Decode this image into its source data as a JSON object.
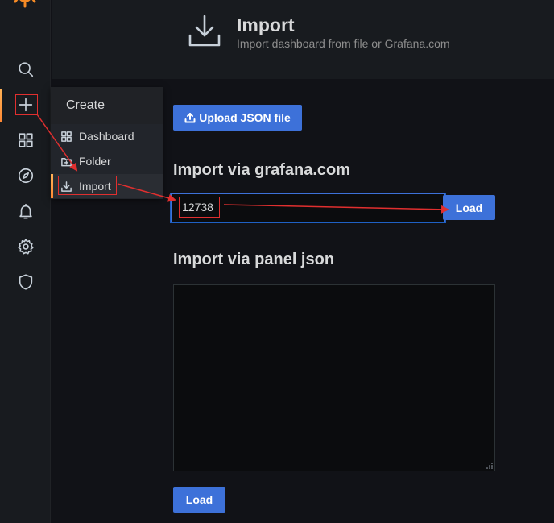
{
  "sidebar": {
    "icons": [
      "grafana-logo",
      "search-icon",
      "plus-icon",
      "apps-icon",
      "compass-icon",
      "bell-icon",
      "gear-icon",
      "shield-icon"
    ]
  },
  "create_menu": {
    "header": "Create",
    "items": [
      {
        "label": "Dashboard",
        "icon": "apps-icon"
      },
      {
        "label": "Folder",
        "icon": "folder-plus-icon"
      },
      {
        "label": "Import",
        "icon": "import-icon"
      }
    ]
  },
  "page_header": {
    "title": "Import",
    "subtitle": "Import dashboard from file or Grafana.com"
  },
  "upload": {
    "label": "Upload JSON file"
  },
  "grafana_com": {
    "section_title": "Import via grafana.com",
    "input_value": "12738",
    "load_label": "Load"
  },
  "panel_json": {
    "section_title": "Import via panel json",
    "load_label": "Load"
  },
  "colors": {
    "primary_button": "#3d71d9",
    "accent_gradient_start": "#ffb357",
    "accent_gradient_end": "#ff8833",
    "annotation_red": "#e02f2f",
    "background": "#111217",
    "panel_background": "#181b1f"
  }
}
